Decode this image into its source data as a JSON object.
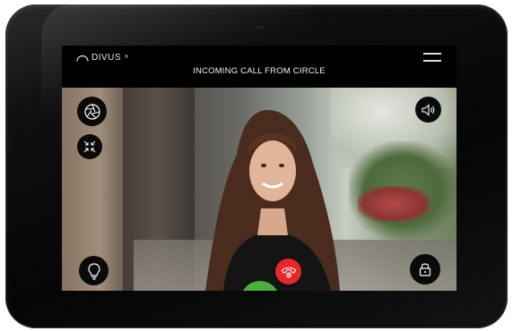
{
  "header": {
    "brand": "DIVUS",
    "brand_reg": "®",
    "title": "INCOMING CALL FROM CIRCLE"
  },
  "icons": {
    "menu": "menu-icon",
    "camera_shutter": "aperture-icon",
    "fullscreen": "compress-arrows-icon",
    "speaker": "speaker-icon",
    "light": "lightbulb-icon",
    "door_lock": "lock-icon",
    "answer": "phone-icon",
    "reject": "phone-hangup-icon"
  },
  "colors": {
    "answer": "#4dae3f",
    "reject": "#e4282b",
    "button_bg": "#0a0a0a"
  }
}
